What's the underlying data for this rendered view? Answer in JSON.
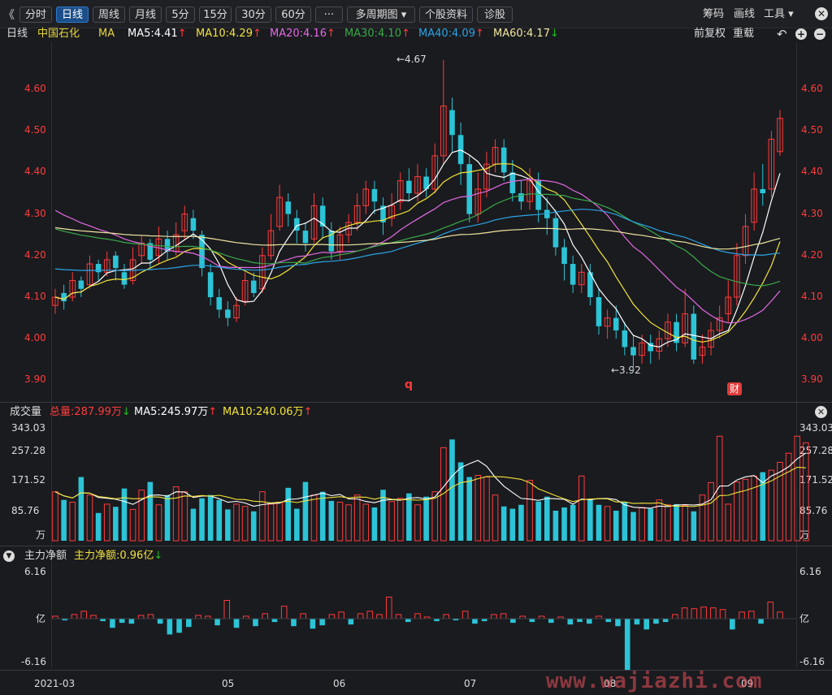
{
  "toolbar": {
    "back_glyph": "《",
    "tabs": [
      "分时",
      "日线",
      "周线",
      "月线",
      "5分",
      "15分",
      "30分",
      "60分",
      "···",
      "多周期图 ▾",
      "个股资料",
      "诊股"
    ],
    "active_tab": "日线",
    "right": [
      "筹码",
      "画线",
      "工具 ▾"
    ]
  },
  "legend": {
    "period": "日线",
    "stock": "中国石化",
    "ma_label": "MA",
    "ma5": "MA5:4.41",
    "ma10": "MA10:4.29",
    "ma20": "MA20:4.16",
    "ma30": "MA30:4.10",
    "ma40": "MA40:4.09",
    "ma60": "MA60:4.17",
    "restore": "前复权",
    "reset": "重载"
  },
  "price_axis": [
    "4.60",
    "4.50",
    "4.40",
    "4.30",
    "4.20",
    "4.10",
    "4.00",
    "3.90"
  ],
  "annotations": {
    "high": "←4.67",
    "low": "←3.92",
    "q_mark": "q",
    "cai_badge": "财"
  },
  "volume": {
    "title": "成交量",
    "total": "总量:287.99万",
    "ma5": "MA5:245.97万",
    "ma10": "MA10:240.06万",
    "axis": [
      "343.03",
      "257.28",
      "171.52",
      "85.76"
    ],
    "unit": "万"
  },
  "fund": {
    "title": "主力净额",
    "value": "主力净额:0.96亿",
    "axis_top": "6.16",
    "axis_bottom": "-6.16",
    "unit": "亿"
  },
  "dates": [
    "2021-03",
    "05",
    "06",
    "07",
    "08",
    "09"
  ],
  "watermark": "www.wajiazhi.com",
  "colors": {
    "up": "#ff3b3b",
    "down": "#2cc4d6",
    "ma5": "#ffffff",
    "ma10": "#f3e33a",
    "ma20": "#e46ae4",
    "ma30": "#3aaa4a",
    "ma40": "#2aa4e6",
    "ma60": "#f0e6a0"
  },
  "chart_data": {
    "type": "candlestick",
    "ylim": [
      3.86,
      4.7
    ],
    "candles": [
      [
        4.08,
        4.1,
        4.06,
        4.12
      ],
      [
        4.11,
        4.09,
        4.07,
        4.13
      ],
      [
        4.1,
        4.14,
        4.09,
        4.16
      ],
      [
        4.14,
        4.12,
        4.1,
        4.15
      ],
      [
        4.13,
        4.18,
        4.12,
        4.2
      ],
      [
        4.18,
        4.16,
        4.14,
        4.19
      ],
      [
        4.16,
        4.19,
        4.15,
        4.21
      ],
      [
        4.2,
        4.17,
        4.14,
        4.21
      ],
      [
        4.16,
        4.13,
        4.12,
        4.18
      ],
      [
        4.14,
        4.19,
        4.13,
        4.22
      ],
      [
        4.2,
        4.23,
        4.18,
        4.25
      ],
      [
        4.23,
        4.19,
        4.17,
        4.24
      ],
      [
        4.2,
        4.24,
        4.18,
        4.27
      ],
      [
        4.24,
        4.21,
        4.19,
        4.26
      ],
      [
        4.21,
        4.25,
        4.2,
        4.28
      ],
      [
        4.26,
        4.3,
        4.24,
        4.32
      ],
      [
        4.29,
        4.26,
        4.24,
        4.31
      ],
      [
        4.25,
        4.17,
        4.15,
        4.26
      ],
      [
        4.16,
        4.1,
        4.08,
        4.18
      ],
      [
        4.1,
        4.07,
        4.05,
        4.12
      ],
      [
        4.07,
        4.05,
        4.03,
        4.09
      ],
      [
        4.05,
        4.08,
        4.04,
        4.1
      ],
      [
        4.09,
        4.14,
        4.08,
        4.16
      ],
      [
        4.14,
        4.11,
        4.1,
        4.16
      ],
      [
        4.12,
        4.2,
        4.11,
        4.22
      ],
      [
        4.2,
        4.26,
        4.19,
        4.3
      ],
      [
        4.27,
        4.34,
        4.26,
        4.37
      ],
      [
        4.33,
        4.3,
        4.27,
        4.35
      ],
      [
        4.29,
        4.26,
        4.23,
        4.31
      ],
      [
        4.26,
        4.23,
        4.21,
        4.28
      ],
      [
        4.24,
        4.32,
        4.23,
        4.35
      ],
      [
        4.32,
        4.27,
        4.24,
        4.34
      ],
      [
        4.26,
        4.21,
        4.19,
        4.28
      ],
      [
        4.21,
        4.25,
        4.19,
        4.27
      ],
      [
        4.25,
        4.28,
        4.23,
        4.3
      ],
      [
        4.28,
        4.32,
        4.26,
        4.35
      ],
      [
        4.32,
        4.36,
        4.3,
        4.38
      ],
      [
        4.36,
        4.33,
        4.3,
        4.38
      ],
      [
        4.32,
        4.28,
        4.25,
        4.34
      ],
      [
        4.29,
        4.32,
        4.27,
        4.35
      ],
      [
        4.33,
        4.38,
        4.31,
        4.4
      ],
      [
        4.38,
        4.35,
        4.33,
        4.41
      ],
      [
        4.35,
        4.39,
        4.33,
        4.42
      ],
      [
        4.39,
        4.36,
        4.34,
        4.41
      ],
      [
        4.36,
        4.44,
        4.35,
        4.47
      ],
      [
        4.44,
        4.56,
        4.42,
        4.67
      ],
      [
        4.55,
        4.49,
        4.45,
        4.58
      ],
      [
        4.49,
        4.42,
        4.37,
        4.52
      ],
      [
        4.42,
        4.3,
        4.28,
        4.44
      ],
      [
        4.3,
        4.36,
        4.28,
        4.4
      ],
      [
        4.36,
        4.42,
        4.34,
        4.45
      ],
      [
        4.42,
        4.46,
        4.4,
        4.48
      ],
      [
        4.46,
        4.4,
        4.38,
        4.48
      ],
      [
        4.4,
        4.35,
        4.33,
        4.43
      ],
      [
        4.35,
        4.33,
        4.31,
        4.38
      ],
      [
        4.33,
        4.38,
        4.31,
        4.41
      ],
      [
        4.38,
        4.31,
        4.28,
        4.4
      ],
      [
        4.31,
        4.29,
        4.25,
        4.34
      ],
      [
        4.29,
        4.22,
        4.2,
        4.31
      ],
      [
        4.22,
        4.18,
        4.14,
        4.24
      ],
      [
        4.18,
        4.13,
        4.11,
        4.2
      ],
      [
        4.13,
        4.16,
        4.11,
        4.18
      ],
      [
        4.16,
        4.1,
        4.08,
        4.18
      ],
      [
        4.1,
        4.03,
        4.01,
        4.12
      ],
      [
        4.03,
        4.05,
        4.0,
        4.07
      ],
      [
        4.05,
        4.02,
        4.0,
        4.08
      ],
      [
        4.02,
        3.98,
        3.96,
        4.04
      ],
      [
        3.98,
        3.96,
        3.92,
        4.01
      ],
      [
        3.96,
        3.99,
        3.94,
        4.01
      ],
      [
        3.99,
        3.97,
        3.94,
        4.01
      ],
      [
        3.97,
        4.0,
        3.95,
        4.02
      ],
      [
        4.0,
        4.04,
        3.98,
        4.06
      ],
      [
        4.04,
        3.99,
        3.97,
        4.06
      ],
      [
        3.99,
        4.06,
        3.98,
        4.12
      ],
      [
        4.06,
        3.95,
        3.94,
        4.08
      ],
      [
        3.96,
        3.98,
        3.94,
        4.01
      ],
      [
        3.98,
        4.02,
        3.96,
        4.04
      ],
      [
        4.02,
        4.05,
        4.0,
        4.08
      ],
      [
        4.06,
        4.1,
        4.04,
        4.14
      ],
      [
        4.1,
        4.2,
        4.08,
        4.23
      ],
      [
        4.2,
        4.27,
        4.18,
        4.3
      ],
      [
        4.28,
        4.36,
        4.26,
        4.4
      ],
      [
        4.36,
        4.35,
        4.32,
        4.42
      ],
      [
        4.36,
        4.48,
        4.34,
        4.5
      ],
      [
        4.45,
        4.53,
        4.44,
        4.55
      ]
    ],
    "volumes": [
      150,
      125,
      118,
      195,
      140,
      85,
      112,
      104,
      160,
      96,
      155,
      180,
      110,
      140,
      165,
      150,
      98,
      130,
      140,
      125,
      96,
      112,
      105,
      90,
      150,
      112,
      118,
      162,
      98,
      180,
      140,
      150,
      122,
      118,
      110,
      140,
      112,
      102,
      156,
      120,
      130,
      145,
      110,
      135,
      150,
      285,
      310,
      240,
      195,
      200,
      195,
      140,
      105,
      98,
      110,
      185,
      120,
      135,
      92,
      102,
      110,
      198,
      125,
      110,
      105,
      92,
      118,
      88,
      102,
      98,
      125,
      110,
      112,
      108,
      90,
      140,
      178,
      320,
      112,
      180,
      188,
      198,
      210,
      216,
      240,
      268,
      320,
      300
    ]
  },
  "fund_data": {
    "values": [
      0.3,
      -0.2,
      0.5,
      0.9,
      0.4,
      -0.3,
      -1.1,
      -0.5,
      -0.6,
      0.4,
      0.5,
      -0.6,
      -1.9,
      -1.7,
      -1.0,
      0.4,
      0.3,
      -0.8,
      2.2,
      -1.1,
      0.3,
      -0.9,
      0.6,
      -0.4,
      1.5,
      -0.9,
      0.6,
      -1.2,
      -0.8,
      0.5,
      0.8,
      -0.7,
      0.6,
      0.9,
      0.5,
      2.6,
      0.5,
      -0.4,
      0.6,
      0.2,
      -0.3,
      0.5,
      -0.2,
      0.9,
      -0.6,
      -0.3,
      0.5,
      0.6,
      -0.5,
      0.3,
      -0.4,
      0.3,
      -0.5,
      0.2,
      -0.7,
      -0.4,
      -0.6,
      0.3,
      -0.4,
      -0.9,
      -6.16,
      -0.7,
      -1.3,
      -0.6,
      -0.4,
      0.5,
      1.3,
      1.2,
      1.4,
      1.3,
      1.1,
      -1.3,
      0.8,
      0.9,
      -0.6,
      2.0,
      0.8
    ]
  }
}
